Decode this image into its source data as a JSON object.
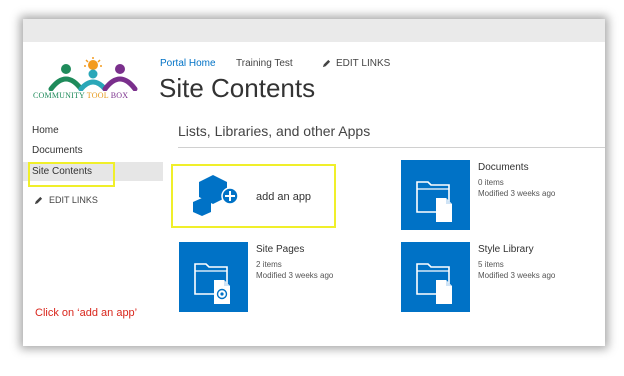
{
  "logo": {
    "text_parts": [
      "COMMUNITY",
      "TOOL",
      "BOX"
    ]
  },
  "breadcrumb": {
    "home": "Portal Home",
    "training": "Training Test",
    "edit_links": "EDIT LINKS"
  },
  "page": {
    "title": "Site Contents",
    "section_heading": "Lists, Libraries, and other Apps"
  },
  "quick_launch": {
    "items": [
      "Home",
      "Documents",
      "Site Contents"
    ],
    "selected": "Site Contents",
    "edit_links": "EDIT LINKS"
  },
  "add_app": {
    "label": "add an app"
  },
  "tiles": [
    {
      "name": "Documents",
      "items": "0 items",
      "modified": "Modified 3 weeks ago",
      "icon": "document-library-icon"
    },
    {
      "name": "Site Pages",
      "items": "2 items",
      "modified": "Modified 3 weeks ago",
      "icon": "site-pages-library-icon"
    },
    {
      "name": "Style Library",
      "items": "5 items",
      "modified": "Modified 3 weeks ago",
      "icon": "document-library-icon"
    }
  ],
  "instruction": "Click on ‘add an app’",
  "colors": {
    "accent": "#0072c6",
    "highlight": "#f0ef2a",
    "instruction": "#d9261c",
    "nav_selected": "#e6e6e6"
  }
}
